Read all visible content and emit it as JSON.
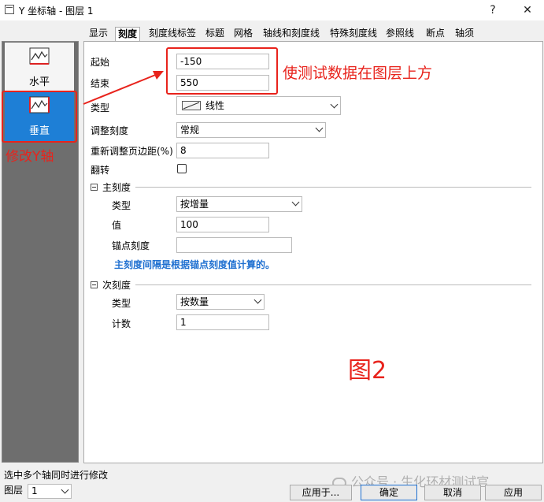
{
  "window": {
    "title": "Y 坐标轴 - 图层 1",
    "help": "?",
    "close": "✕"
  },
  "sidebar": {
    "items": [
      {
        "label": "水平"
      },
      {
        "label": "垂直"
      }
    ]
  },
  "tabs": [
    "显示",
    "刻度",
    "刻度线标签",
    "标题",
    "网格",
    "轴线和刻度线",
    "特殊刻度线",
    "参照线",
    "断点",
    "轴须"
  ],
  "scale": {
    "start_label": "起始",
    "start_value": "-150",
    "end_label": "结束",
    "end_value": "550",
    "type_label": "类型",
    "type_value": "线性",
    "rescale_label": "调整刻度",
    "rescale_value": "常规",
    "margin_label": "重新调整页边距(%)",
    "margin_value": "8",
    "reverse_label": "翻转"
  },
  "major": {
    "header": "主刻度",
    "type_label": "类型",
    "type_value": "按增量",
    "value_label": "值",
    "value": "100",
    "anchor_label": "锚点刻度",
    "anchor_value": "",
    "note": "主刻度间隔是根据锚点刻度值计算的。"
  },
  "minor": {
    "header": "次刻度",
    "type_label": "类型",
    "type_value": "按数量",
    "count_label": "计数",
    "count_value": "1"
  },
  "annotations": {
    "top_note": "使测试数据在图层上方",
    "side_note": "修改Y轴",
    "figure_label": "图2",
    "accent": "#e8231c"
  },
  "footer": {
    "status": "选中多个轴同时进行修改",
    "layer_label": "图层",
    "layer_value": "1",
    "apply_to": "应用于...",
    "ok": "确定",
    "cancel": "取消",
    "apply": "应用"
  },
  "watermark": "公众号 · 生化环材测试官"
}
